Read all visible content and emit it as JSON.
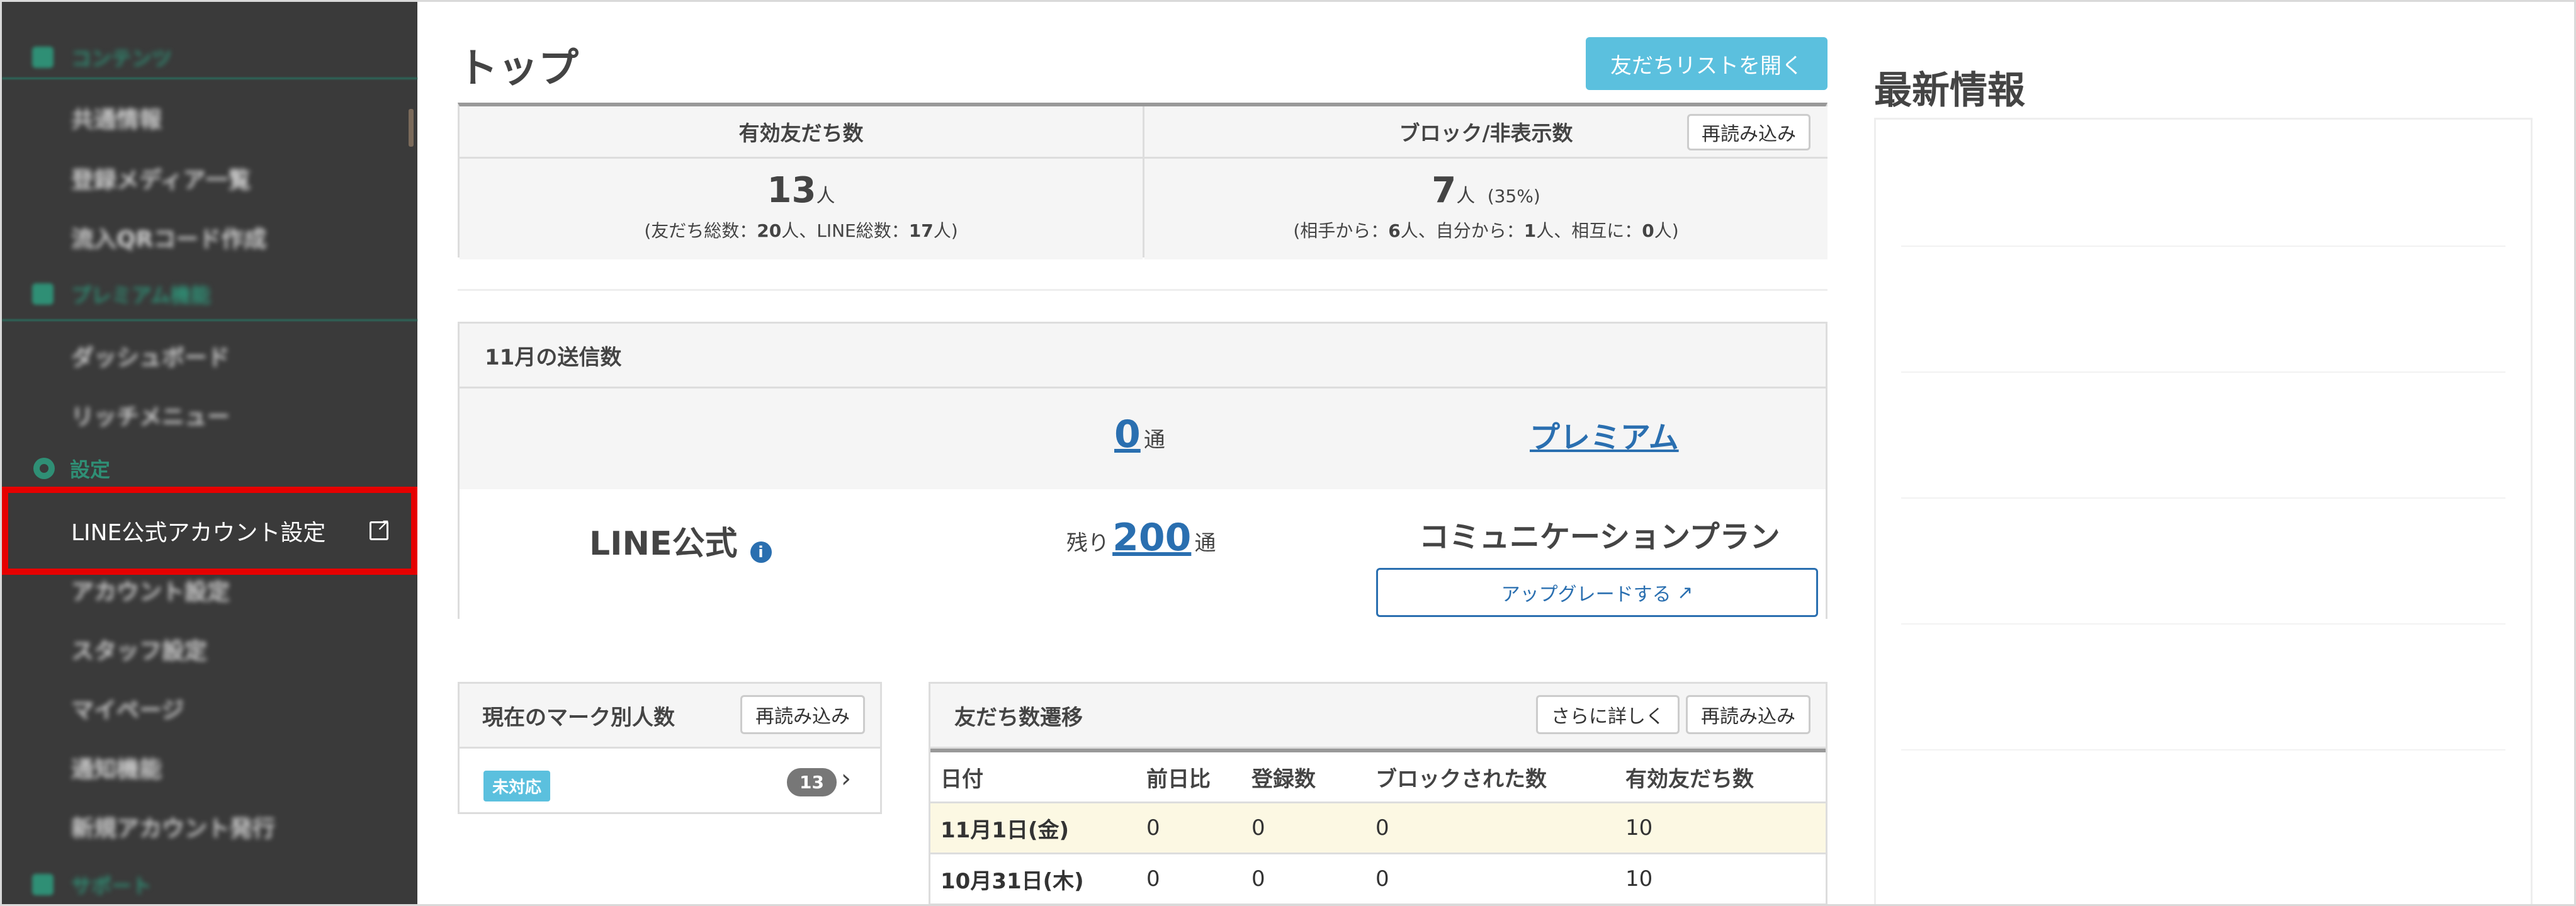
{
  "sidebar": {
    "top_group": "コンテンツ",
    "content_items": [
      "共通情報",
      "登録メディア一覧",
      "流入QRコード作成"
    ],
    "premium_group": "プレミアム機能",
    "premium_items": [
      "ダッシュボード",
      "リッチメニュー"
    ],
    "settings_group": "設定",
    "highlighted_item": "LINE公式アカウント設定",
    "settings_items": [
      "アカウント設定",
      "スタッフ設定",
      "マイページ",
      "通知機能",
      "新規アカウント発行"
    ],
    "bottom_group": "サポート"
  },
  "header": {
    "title": "トップ",
    "friend_list_button": "友だちリストを開く"
  },
  "stats": {
    "valid_friends_label": "有効友だち数",
    "valid_friends_value": "13",
    "person_unit": "人",
    "valid_friends_sub_prefix": "(友だち総数：",
    "valid_friends_total": "20",
    "valid_friends_sub_mid": "人、LINE総数：",
    "valid_friends_line_total": "17",
    "valid_friends_sub_suffix": "人)",
    "block_label": "ブロック/非表示数",
    "reload_button": "再読み込み",
    "block_value": "7",
    "block_pct": "(35%)",
    "block_sub_1": "(相手から：",
    "block_from_partner": "6",
    "block_sub_2": "人、自分から：",
    "block_from_self": "1",
    "block_sub_3": "人、相互に：",
    "block_mutual": "0",
    "block_sub_4": "人)"
  },
  "sends": {
    "title": "11月の送信数",
    "sent_count": "0",
    "unit": "通",
    "plan_link": "プレミアム",
    "line_label": "LINE公式",
    "info_icon": "i",
    "remaining_label": "残り",
    "remaining_count": "200",
    "plan_name": "コミュニケーションプラン",
    "upgrade_button": "アップグレードする"
  },
  "marks": {
    "title": "現在のマーク別人数",
    "reload_button": "再読み込み",
    "badge": "未対応",
    "count": "13"
  },
  "trend": {
    "title": "友だち数遷移",
    "more_button": "さらに詳しく",
    "reload_button": "再読み込み",
    "columns": [
      "日付",
      "前日比",
      "登録数",
      "ブロックされた数",
      "有効友だち数"
    ],
    "rows": [
      [
        "11月1日(金)",
        "0",
        "0",
        "0",
        "10"
      ],
      [
        "10月31日(木)",
        "0",
        "0",
        "0",
        "10"
      ]
    ]
  },
  "news": {
    "title": "最新情報"
  },
  "colors": {
    "sidebar_bg": "#3a3a3a",
    "accent_green": "#2f8f75",
    "highlight_red": "#e60000",
    "primary_button": "#5bc0de",
    "link_blue": "#2a6fb0"
  }
}
